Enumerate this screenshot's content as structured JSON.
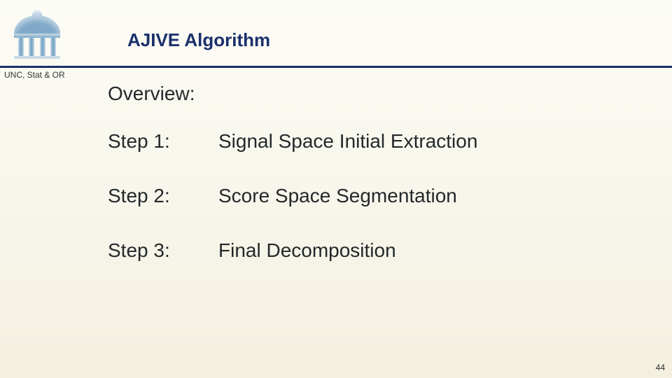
{
  "header": {
    "title": "AJIVE Algorithm",
    "subheader": "UNC, Stat & OR"
  },
  "content": {
    "overview": "Overview:",
    "steps": [
      {
        "label": "Step 1:",
        "desc": "Signal Space Initial Extraction"
      },
      {
        "label": "Step 2:",
        "desc": "Score Space Segmentation"
      },
      {
        "label": "Step 3:",
        "desc": "Final Decomposition"
      }
    ]
  },
  "footer": {
    "page_number": "44"
  }
}
